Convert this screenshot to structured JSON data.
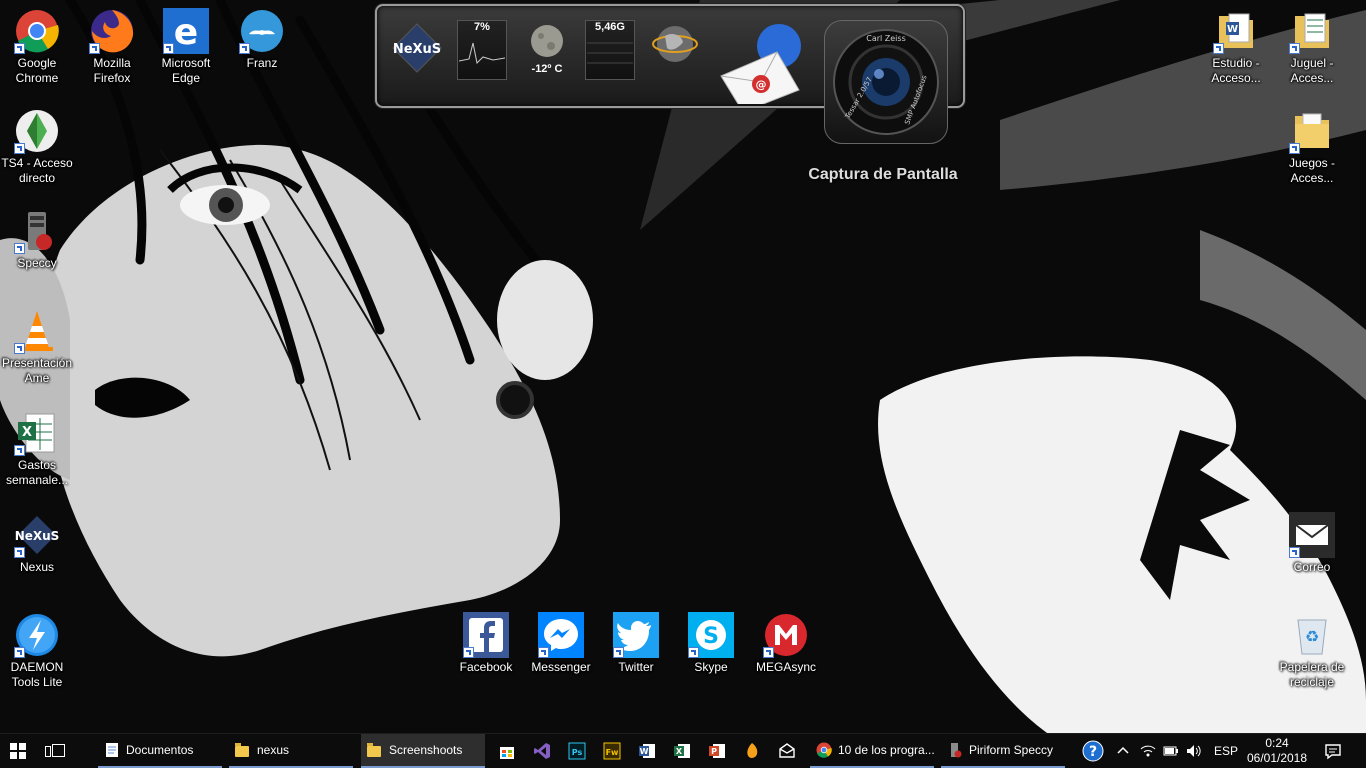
{
  "desktop": {
    "left_icons": [
      {
        "name": "google-chrome-shortcut",
        "label": "Google Chrome"
      },
      {
        "name": "mozilla-firefox-shortcut",
        "label": "Mozilla Firefox"
      },
      {
        "name": "microsoft-edge-shortcut",
        "label": "Microsoft Edge"
      },
      {
        "name": "franz-shortcut",
        "label": "Franz"
      },
      {
        "name": "ts4-shortcut",
        "label": "TS4 - Acceso directo"
      },
      {
        "name": "speccy-shortcut",
        "label": "Speccy"
      },
      {
        "name": "presentacion-ame-shortcut",
        "label": "Presentación Ame"
      },
      {
        "name": "gastos-semanales-shortcut",
        "label": "Gastos semanale..."
      },
      {
        "name": "nexus-shortcut",
        "label": "Nexus"
      },
      {
        "name": "daemon-tools-shortcut",
        "label": "DAEMON Tools Lite"
      }
    ],
    "right_icons": [
      {
        "name": "estudio-shortcut",
        "label": "Estudio - Acceso..."
      },
      {
        "name": "juguel-shortcut",
        "label": "Juguel - Acces..."
      },
      {
        "name": "juegos-shortcut",
        "label": "Juegos - Acces..."
      },
      {
        "name": "correo-shortcut",
        "label": "Correo"
      },
      {
        "name": "recycle-bin",
        "label": "Papelera de reciclaje"
      }
    ],
    "bottom_icons": [
      {
        "name": "facebook-shortcut",
        "label": "Facebook",
        "color": "#3b5998"
      },
      {
        "name": "messenger-shortcut",
        "label": "Messenger",
        "color": "#0084ff"
      },
      {
        "name": "twitter-shortcut",
        "label": "Twitter",
        "color": "#1da1f2"
      },
      {
        "name": "skype-shortcut",
        "label": "Skype",
        "color": "#00aff0"
      },
      {
        "name": "megasync-shortcut",
        "label": "MEGAsync",
        "color": "#d9272e"
      }
    ]
  },
  "dock": {
    "logo": "NeXuS",
    "cpu": "7%",
    "weather": "-12º C",
    "memory": "5,46G",
    "capture_label": "Captura de Pantalla",
    "camera_lens_text_top": "Carl Zeiss",
    "camera_lens_text_left": "Tessar 2.0/57",
    "camera_lens_text_right": "SMP Autofocus"
  },
  "taskbar": {
    "apps": [
      {
        "name": "taskbar-documentos",
        "label": "Documentos"
      },
      {
        "name": "taskbar-nexus",
        "label": "nexus"
      },
      {
        "name": "taskbar-screenshoots",
        "label": "Screenshoots"
      },
      {
        "name": "taskbar-chrome",
        "label": "10 de los progra..."
      },
      {
        "name": "taskbar-speccy",
        "label": "Piriform Speccy"
      }
    ],
    "language": "ESP",
    "time": "0:24",
    "date": "06/01/2018"
  },
  "colors": {
    "taskbar_bg": "#0c0c0c",
    "active_underline": "#7a9bcf"
  }
}
